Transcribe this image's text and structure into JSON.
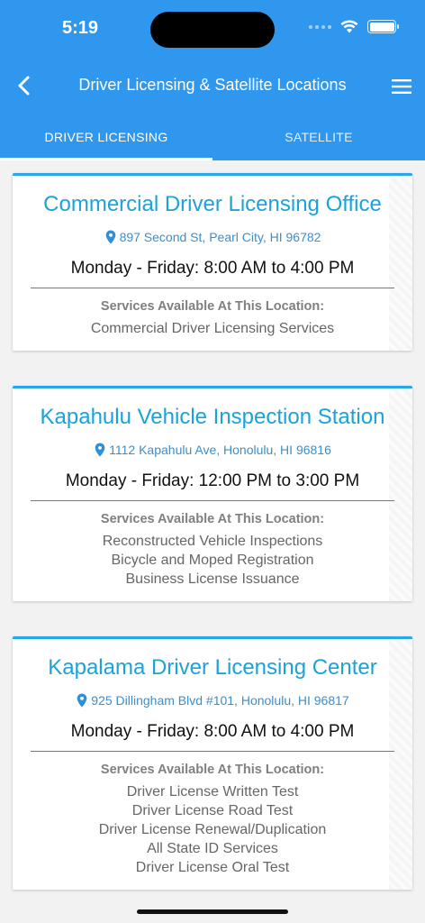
{
  "status": {
    "time": "5:19"
  },
  "header": {
    "title": "Driver Licensing & Satellite Locations"
  },
  "tabs": [
    {
      "label": "DRIVER LICENSING",
      "active": true
    },
    {
      "label": "SATELLITE",
      "active": false
    }
  ],
  "locations": [
    {
      "name": "Commercial Driver Licensing Office",
      "address": "897 Second St, Pearl City, HI 96782",
      "hours": "Monday - Friday: 8:00 AM to 4:00 PM",
      "services_heading": "Services Available At This Location:",
      "services": [
        "Commercial Driver Licensing Services"
      ]
    },
    {
      "name": "Kapahulu Vehicle Inspection Station",
      "address": "1112 Kapahulu Ave, Honolulu, HI 96816",
      "hours": "Monday - Friday: 12:00 PM to 3:00 PM",
      "services_heading": "Services Available At This Location:",
      "services": [
        "Reconstructed Vehicle Inspections",
        "Bicycle and Moped Registration",
        "Business License Issuance"
      ]
    },
    {
      "name": "Kapalama Driver Licensing Center",
      "address": "925 Dillingham Blvd #101, Honolulu, HI 96817",
      "hours": "Monday - Friday: 8:00 AM to 4:00 PM",
      "services_heading": "Services Available At This Location:",
      "services": [
        "Driver License Written Test",
        "Driver License Road Test",
        "Driver License Renewal/Duplication",
        "All State ID Services",
        "Driver License Oral Test"
      ]
    }
  ],
  "colors": {
    "header": "#2f97ee",
    "accent": "#1ba3d9",
    "address": "#3d8ec9"
  },
  "icons": {
    "back": "chevron-left-icon",
    "menu": "hamburger-menu-icon",
    "pin": "map-pin-icon"
  }
}
